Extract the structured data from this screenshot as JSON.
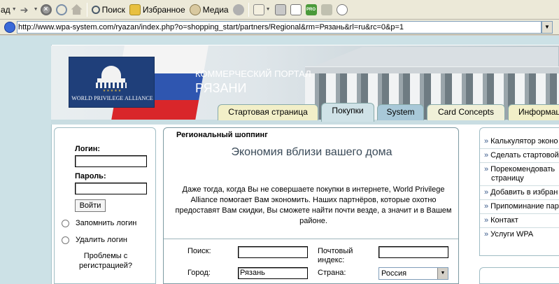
{
  "browser": {
    "toolbar": {
      "back_label": "ад",
      "search_label": "Поиск",
      "favorites_label": "Избранное",
      "media_label": "Медиа",
      "pro_label": "PRO"
    },
    "address": {
      "url": "http://www.wpa-system.com/ryazan/index.php?o=shopping_start/partners/Regional&rm=Рязань&rl=ru&rc=0&p=1"
    }
  },
  "header": {
    "logo_text": "WORLD PRIVILEGE ALLIANCE",
    "logo_stars": "★★★★★",
    "portal_title": "КОММЕРЧЕСКИЙ ПОРТАЛ",
    "portal_city": "РЯЗАНИ",
    "tabs": [
      {
        "label": "Стартовая страница",
        "active": false,
        "color": "#f2efc8"
      },
      {
        "label": "Покупки",
        "active": true,
        "color": "#cfe2e7"
      },
      {
        "label": "System",
        "active": false,
        "color": "#a8c8d8"
      },
      {
        "label": "Card Concepts",
        "active": false,
        "color": "#f0f0d8"
      },
      {
        "label": "Информац",
        "active": false,
        "color": "#f2efc8"
      }
    ]
  },
  "login": {
    "login_label": "Логин:",
    "login_value": "",
    "password_label": "Пароль:",
    "password_value": "",
    "submit_label": "Войти",
    "remember_label": "Запомнить логин",
    "delete_label": "Удалить логин",
    "problems_line1": "Проблемы с",
    "problems_line2": "регистрацией?"
  },
  "main": {
    "section_header": "Региональный шоппинг",
    "title": "Экономия вблизи вашего дома",
    "body_lines": [
      "Даже тогда, когда Вы не совершаете покупки в интернете, World Privilege",
      "Alliance помогает Вам экономить. Наших партнёров, которые охотно",
      "предоставят Вам скидки, Вы сможете найти почти везде, а значит и в Вашем",
      "районе."
    ],
    "form": {
      "search_label": "Поиск:",
      "search_value": "",
      "zip_label_line1": "Почтовый",
      "zip_label_line2": "индекс:",
      "zip_value": "",
      "city_label": "Город:",
      "city_value": "Рязань",
      "country_label": "Страна:",
      "country_value": "Россия"
    }
  },
  "sidebar": {
    "items": [
      {
        "label": "Калькулятор эконо"
      },
      {
        "label": "Сделать стартовой"
      },
      {
        "label": "Порекомендовать",
        "label2": "страницу"
      },
      {
        "label": "Добавить в избран"
      },
      {
        "label": "Припоминание паро"
      },
      {
        "label": "Контакт"
      },
      {
        "label": "Услуги WPA"
      }
    ],
    "chevron": "»"
  }
}
